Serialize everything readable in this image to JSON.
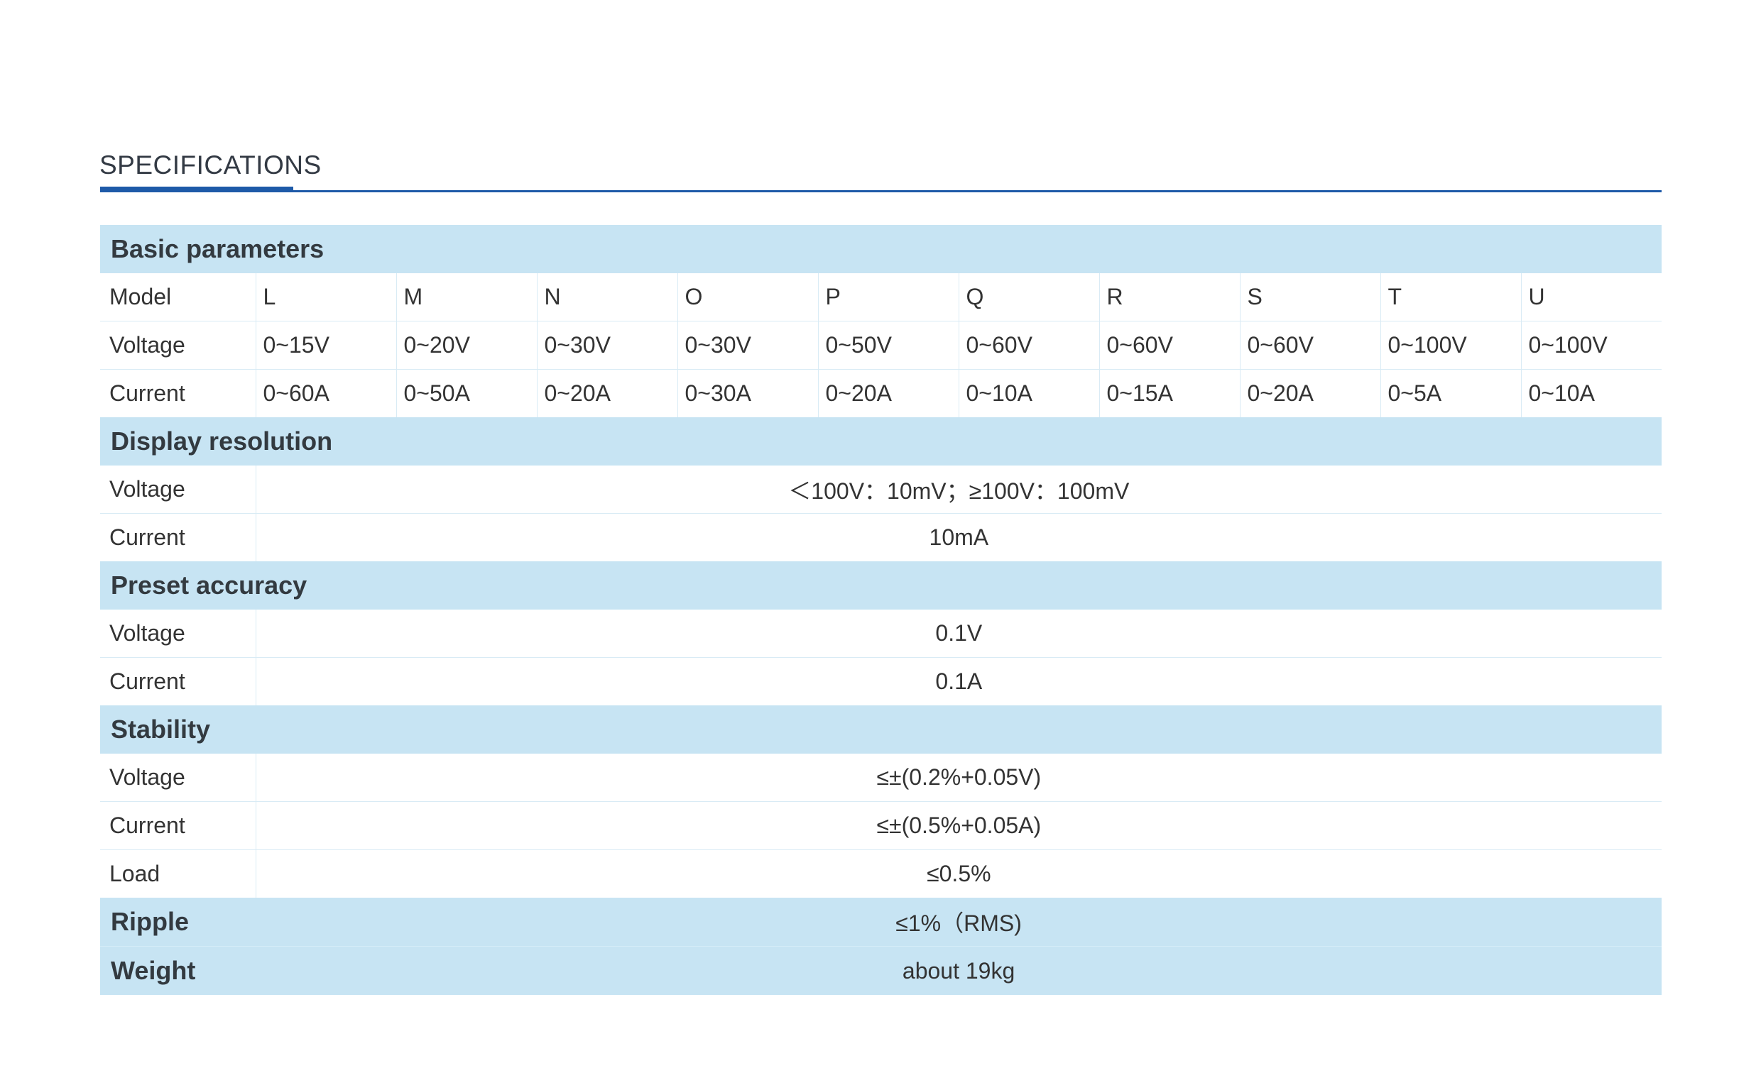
{
  "header": {
    "title": "SPECIFICATIONS"
  },
  "basic": {
    "title": "Basic parameters",
    "model_label": "Model",
    "voltage_label": "Voltage",
    "current_label": "Current",
    "models": [
      "L",
      "M",
      "N",
      "O",
      "P",
      "Q",
      "R",
      "S",
      "T",
      "U"
    ],
    "voltages": [
      "0~15V",
      "0~20V",
      "0~30V",
      "0~30V",
      "0~50V",
      "0~60V",
      "0~60V",
      "0~60V",
      "0~100V",
      "0~100V"
    ],
    "currents": [
      "0~60A",
      "0~50A",
      "0~20A",
      "0~30A",
      "0~20A",
      "0~10A",
      "0~15A",
      "0~20A",
      "0~5A",
      "0~10A"
    ]
  },
  "resolution": {
    "title": "Display resolution",
    "voltage_label": "Voltage",
    "voltage_value": "＜100V：10mV；≥100V：100mV",
    "current_label": "Current",
    "current_value": "10mA"
  },
  "accuracy": {
    "title": "Preset accuracy",
    "voltage_label": "Voltage",
    "voltage_value": "0.1V",
    "current_label": "Current",
    "current_value": "0.1A"
  },
  "stability": {
    "title": "Stability",
    "voltage_label": "Voltage",
    "voltage_value": "≤±(0.2%+0.05V)",
    "current_label": "Current",
    "current_value": "≤±(0.5%+0.05A)",
    "load_label": "Load",
    "load_value": "≤0.5%"
  },
  "ripple": {
    "label": "Ripple",
    "value": "≤1%（RMS)"
  },
  "weight": {
    "label": "Weight",
    "value": "about 19kg"
  }
}
